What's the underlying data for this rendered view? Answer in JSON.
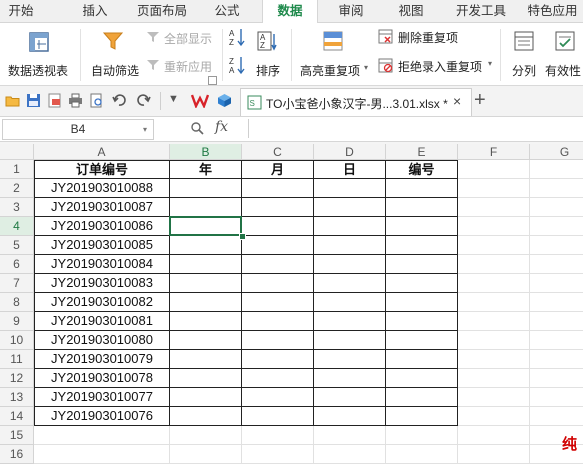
{
  "menu_tabs": [
    "开始",
    "插入",
    "页面布局",
    "公式",
    "数据",
    "审阅",
    "视图",
    "开发工具",
    "特色应用"
  ],
  "active_tab": "数据",
  "ribbon": {
    "pivot_table": "数据透视表",
    "auto_filter": "自动筛选",
    "show_all": "全部显示",
    "reapply": "重新应用",
    "sort": "排序",
    "highlight_duplicates": "高亮重复项",
    "remove_duplicates": "删除重复项",
    "reject_duplicates": "拒绝录入重复项",
    "split": "分列",
    "validity": "有效性"
  },
  "document_tab": {
    "title": "TO小宝爸小象汉字-男...3.01.xlsx *",
    "close": "×",
    "new_tab": "+"
  },
  "formula_bar": {
    "cell_ref": "B4",
    "fx_label": "fx",
    "value": ""
  },
  "sheet": {
    "columns": [
      "A",
      "B",
      "C",
      "D",
      "E",
      "F",
      "G"
    ],
    "selected_column": "B",
    "selected_row": 4,
    "row_numbers": [
      1,
      2,
      3,
      4,
      5,
      6,
      7,
      8,
      9,
      10,
      11,
      12,
      13,
      14,
      15,
      16
    ],
    "headers": [
      "订单编号",
      "年",
      "月",
      "日",
      "编号"
    ],
    "order_ids": [
      "JY201903010088",
      "JY201903010087",
      "JY201903010086",
      "JY201903010085",
      "JY201903010084",
      "JY201903010083",
      "JY201903010082",
      "JY201903010081",
      "JY201903010080",
      "JY201903010079",
      "JY201903010078",
      "JY201903010077",
      "JY201903010076"
    ]
  },
  "watermark": "纯",
  "colors": {
    "accent": "#1f8a4c",
    "selection_border": "#217346",
    "watermark": "#d10000"
  }
}
